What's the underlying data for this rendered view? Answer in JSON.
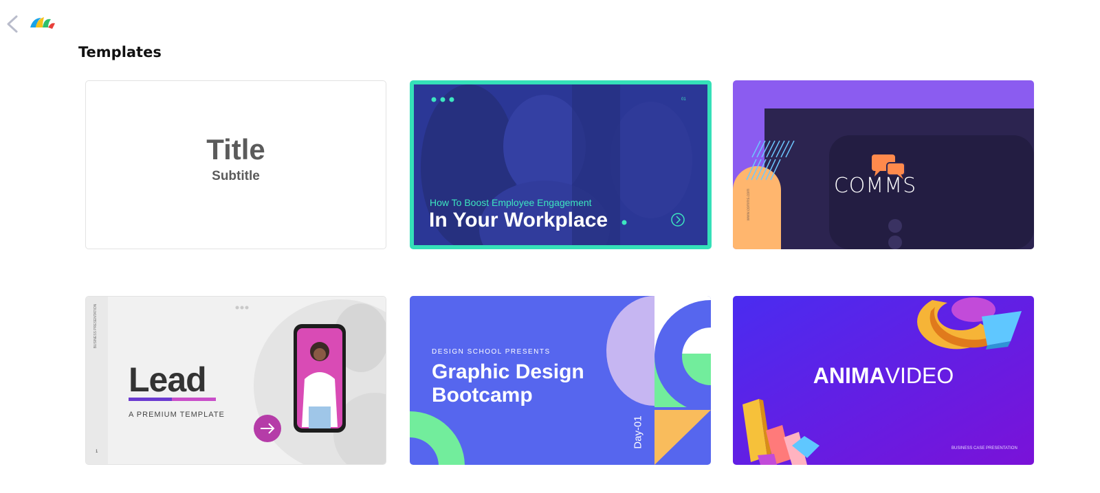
{
  "page": {
    "heading": "Templates"
  },
  "cards": [
    {
      "title": "Title",
      "subtitle": "Subtitle"
    },
    {
      "kicker": "How To Boost Employee Engagement",
      "headline": "In Your Workplace",
      "page_num": "01"
    },
    {
      "brand": "COMMS",
      "side_text": "www.comms.com"
    },
    {
      "headline": "Lead",
      "tagline": "A PREMIUM TEMPLATE",
      "side_text": "BUSINESS PRESENTATION",
      "page_num": "1"
    },
    {
      "kicker": "DESIGN SCHOOL PRESENTS",
      "headline_1": "Graphic Design",
      "headline_2": "Bootcamp",
      "day": "Day-01"
    },
    {
      "brand_bold": "ANIMA",
      "brand_light": "VIDEO",
      "footer": "BUSINESS CASE PRESENTATION"
    }
  ],
  "colors": {
    "accent_selected": "#35e0b8",
    "comms_purple": "#8b5cf0",
    "bootcamp_blue": "#5666ee",
    "anima_violet": "#6b1fe0"
  }
}
